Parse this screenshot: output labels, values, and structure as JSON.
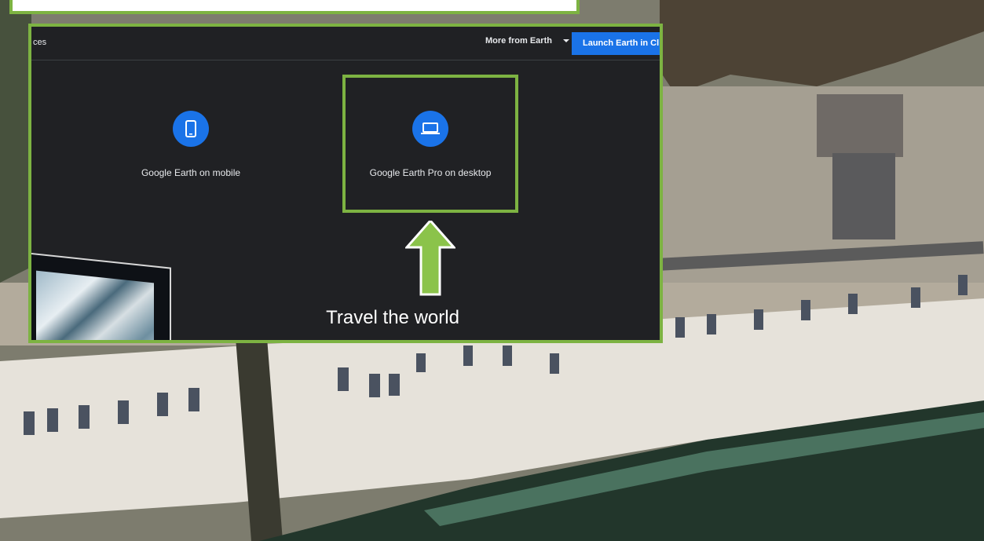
{
  "embedded_page": {
    "nav_fragment": "ces",
    "more_from_earth": "More from Earth",
    "launch_button": "Launch Earth in Cl",
    "options": [
      {
        "label": "Google Earth on mobile",
        "icon": "smartphone-icon"
      },
      {
        "label": "Google Earth Pro on desktop",
        "icon": "laptop-icon"
      }
    ],
    "caption": "Travel the world"
  },
  "colors": {
    "highlight_green": "#7db342",
    "earth_blue": "#1a73e8",
    "panel_dark": "#202124"
  }
}
